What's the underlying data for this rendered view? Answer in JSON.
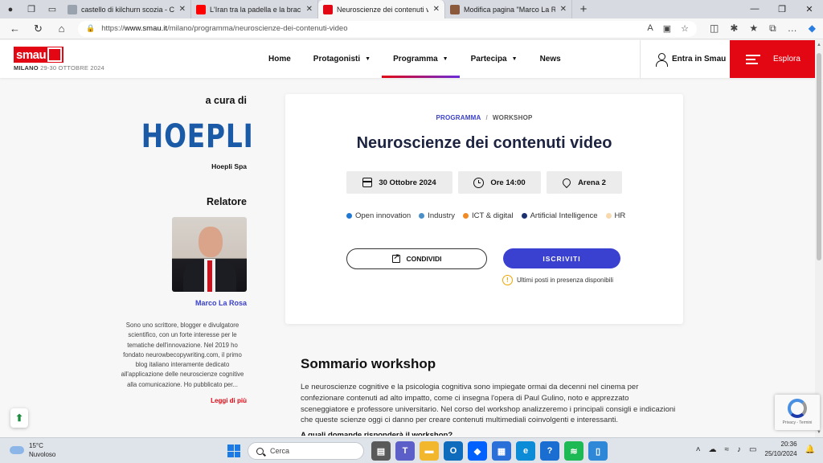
{
  "browser": {
    "tabs": [
      {
        "title": "castello di kilchurn scozia - Cerca",
        "icon": "search-icon",
        "color": "#9aa3ad"
      },
      {
        "title": "L'Iran tra la padella e la brac",
        "icon": "youtube-icon",
        "color": "#ff0000"
      },
      {
        "title": "Neuroscienze dei contenuti video",
        "icon": "smau-icon",
        "color": "#e30613"
      },
      {
        "title": "Modifica pagina \"Marco La Rosa\"",
        "icon": "profile-icon",
        "color": "#8b5a3c"
      }
    ],
    "url_prefix": "https://",
    "url_host": "www.smau.it",
    "url_path": "/milano/programma/neuroscienze-dei-contenuti-video"
  },
  "header": {
    "logo_text": "smau",
    "logo_city": "MILANO",
    "logo_dates": "29-30 OTTOBRE 2024",
    "menu": [
      {
        "label": "Home",
        "caret": false,
        "active": false
      },
      {
        "label": "Protagonisti",
        "caret": true,
        "active": false
      },
      {
        "label": "Programma",
        "caret": true,
        "active": true
      },
      {
        "label": "Partecipa",
        "caret": true,
        "active": false
      },
      {
        "label": "News",
        "caret": false,
        "active": false
      }
    ],
    "login_label": "Entra in Smau",
    "explore_label": "Esplora",
    "accent_color": "#e30613"
  },
  "sidebar": {
    "curated_by": "a cura di",
    "sponsor_logo": "HOEPLI",
    "sponsor_name": "Hoepli Spa",
    "speaker_heading": "Relatore",
    "speaker_name": "Marco La Rosa",
    "speaker_bio": "Sono uno scrittore, blogger e divulgatore scientifico, con un forte interesse per le tematiche dell'innovazione. Nel 2019 ho fondato neurowbecopywriting.com, il primo blog italiano interamente dedicato all'applicazione delle neuroscienze cognitive alla comunicazione. Ho pubblicato per...",
    "read_more": "Leggi di più"
  },
  "event": {
    "crumb_category": "PROGRAMMA",
    "crumb_sep": "/",
    "crumb_type": "WORKSHOP",
    "title": "Neuroscienze dei contenuti video",
    "date": "30 Ottobre 2024",
    "time": "Ore 14:00",
    "location": "Arena 2",
    "tags": [
      {
        "label": "Open innovation",
        "color": "#1f78d1"
      },
      {
        "label": "Industry",
        "color": "#4a8fc7"
      },
      {
        "label": "ICT & digital",
        "color": "#f08a24"
      },
      {
        "label": "Artificial Intelligence",
        "color": "#1c3070"
      },
      {
        "label": "HR",
        "color": "#f7d9b0"
      }
    ],
    "share_label": "CONDIVIDI",
    "subscribe_label": "ISCRIVITI",
    "availability": "Ultimi posti in presenza disponibili",
    "subscribe_color": "#3a41d0"
  },
  "summary": {
    "heading": "Sommario workshop",
    "body": "Le neuroscienze cognitive e la psicologia cognitiva sono impiegate ormai da decenni nel cinema per confezionare contenuti ad alto impatto, come ci insegna l'opera di Paul Gulino, noto e apprezzato sceneggiatore e professore universitario. Nel corso del workshop analizzeremo i principali consigli e indicazioni che queste scienze oggi ci danno per creare contenuti multimediali coinvolgenti e interessanti.",
    "question": "A quali domande risponderà il workshop?"
  },
  "recaptcha": {
    "text": "Privacy - Termini"
  },
  "taskbar": {
    "temp": "15°C",
    "weather": "Nuvoloso",
    "search_placeholder": "Cerca",
    "time": "20:36",
    "date": "25/10/2024",
    "apps": [
      {
        "icon": "files-icon",
        "color": "#5a5a5a"
      },
      {
        "icon": "teams-icon",
        "color": "#5b5fc7"
      },
      {
        "icon": "folder-icon",
        "color": "#f3b72e"
      },
      {
        "icon": "outlook-icon",
        "color": "#0f6cbd"
      },
      {
        "icon": "dropbox-icon",
        "color": "#0061fe"
      },
      {
        "icon": "calendar-icon",
        "color": "#2b6fd8"
      },
      {
        "icon": "edge-icon",
        "color": "#0c8bd6"
      },
      {
        "icon": "help-icon",
        "color": "#1b6ed1"
      },
      {
        "icon": "spotify-icon",
        "color": "#1db954"
      },
      {
        "icon": "notepad-icon",
        "color": "#2f87d8"
      }
    ]
  }
}
